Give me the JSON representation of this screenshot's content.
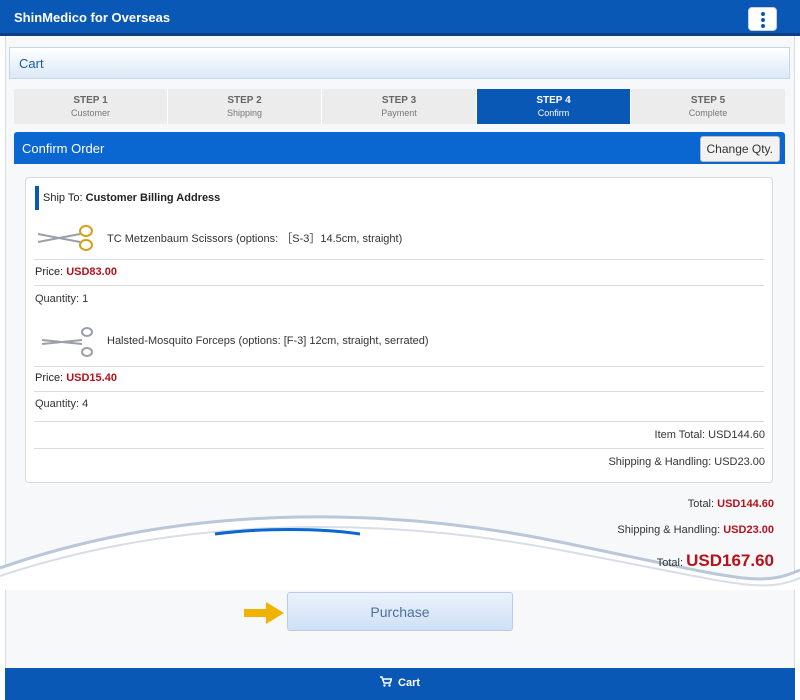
{
  "app": {
    "title": "ShinMedico for Overseas"
  },
  "cart_header": {
    "label": "Cart"
  },
  "steps": [
    {
      "num": "STEP 1",
      "label": "Customer"
    },
    {
      "num": "STEP 2",
      "label": "Shipping"
    },
    {
      "num": "STEP 3",
      "label": "Payment"
    },
    {
      "num": "STEP 4",
      "label": "Confirm",
      "active": true
    },
    {
      "num": "STEP 5",
      "label": "Complete"
    }
  ],
  "confirm": {
    "title": "Confirm Order",
    "change_qty": "Change Qty."
  },
  "ship_to": {
    "prefix": "Ship To:",
    "name": "Customer Billing Address"
  },
  "items": [
    {
      "name": "TC Metzenbaum Scissors (options: ［S-3］14.5cm, straight)",
      "price_label": "Price:",
      "price": "USD83.00",
      "quantity_label": "Quantity: 1",
      "thumb_icon": "scissors-icon"
    },
    {
      "name": "Halsted-Mosquito Forceps (options: [F-3] 12cm, straight, serrated)",
      "price_label": "Price:",
      "price": "USD15.40",
      "quantity_label": "Quantity: 4",
      "thumb_icon": "forceps-icon"
    }
  ],
  "card_totals": {
    "item_total": "Item Total: USD144.60",
    "shipping": "Shipping & Handling: USD23.00"
  },
  "summary": {
    "total_label": "Total:",
    "total_value": "USD144.60",
    "shipping_label": "Shipping & Handling:",
    "shipping_value": "USD23.00",
    "grand_label": "Total:",
    "grand_value": "USD167.60"
  },
  "purchase": {
    "label": "Purchase"
  },
  "bottom_bar": {
    "label": "Cart",
    "icon": "cart-icon"
  },
  "colors": {
    "primary": "#0a58b5",
    "price_red": "#b5121b",
    "arrow": "#f2b200"
  }
}
